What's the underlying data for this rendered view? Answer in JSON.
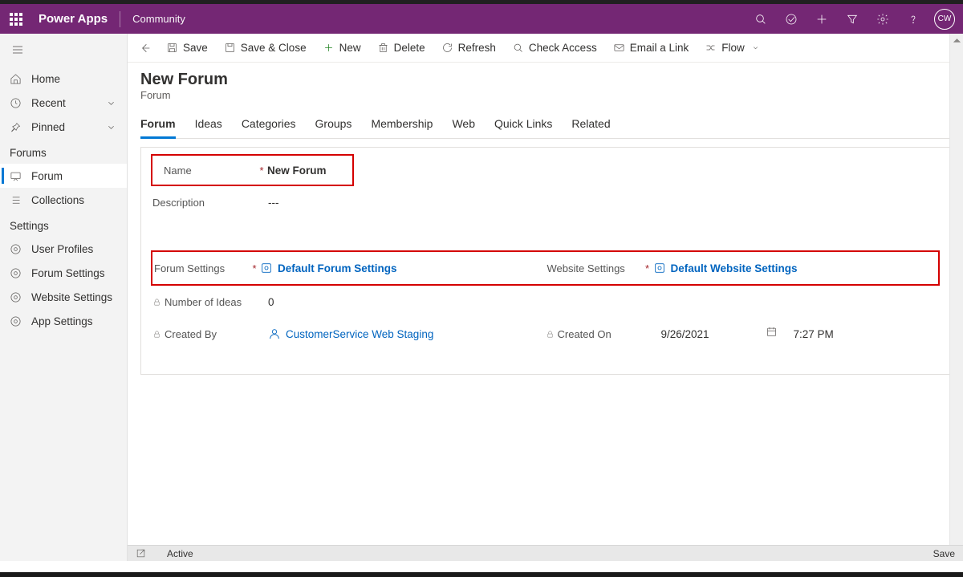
{
  "header": {
    "brand": "Power Apps",
    "env": "Community",
    "avatar": "CW"
  },
  "sidebar": {
    "nav": [
      {
        "label": "Home"
      },
      {
        "label": "Recent"
      },
      {
        "label": "Pinned"
      }
    ],
    "section1": "Forums",
    "items1": [
      {
        "label": "Forum"
      },
      {
        "label": "Collections"
      }
    ],
    "section2": "Settings",
    "items2": [
      {
        "label": "User Profiles"
      },
      {
        "label": "Forum Settings"
      },
      {
        "label": "Website Settings"
      },
      {
        "label": "App Settings"
      }
    ]
  },
  "cmd": {
    "save": "Save",
    "saveclose": "Save & Close",
    "new": "New",
    "delete": "Delete",
    "refresh": "Refresh",
    "check": "Check Access",
    "email": "Email a Link",
    "flow": "Flow"
  },
  "page": {
    "title": "New Forum",
    "subtitle": "Forum"
  },
  "tabs": [
    "Forum",
    "Ideas",
    "Categories",
    "Groups",
    "Membership",
    "Web",
    "Quick Links",
    "Related"
  ],
  "form": {
    "name_label": "Name",
    "name_value": "New Forum",
    "desc_label": "Description",
    "desc_value": "---",
    "fs_label": "Forum Settings",
    "fs_value": "Default Forum Settings",
    "ws_label": "Website Settings",
    "ws_value": "Default Website Settings",
    "ni_label": "Number of Ideas",
    "ni_value": "0",
    "cb_label": "Created By",
    "cb_value": "CustomerService Web Staging",
    "co_label": "Created On",
    "co_date": "9/26/2021",
    "co_time": "7:27 PM"
  },
  "status": {
    "state": "Active",
    "save": "Save"
  }
}
